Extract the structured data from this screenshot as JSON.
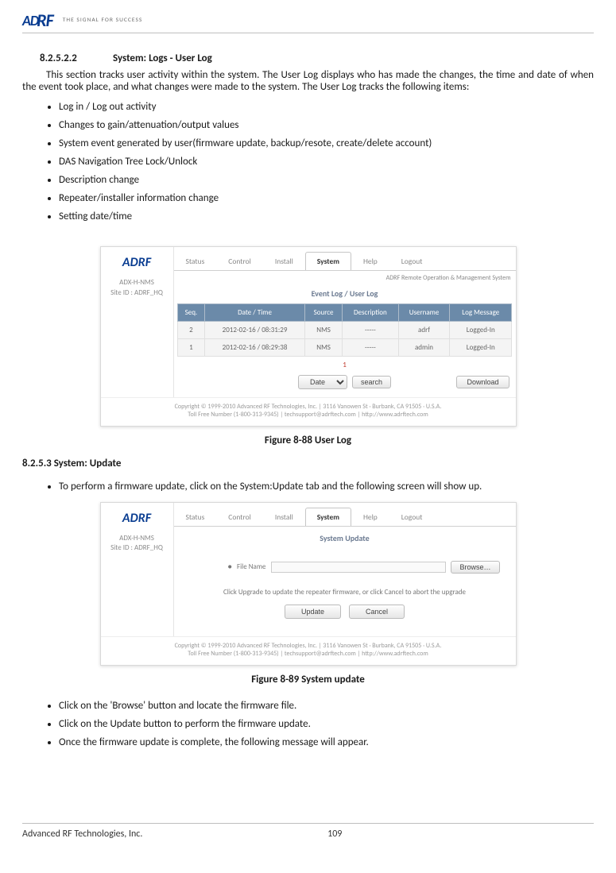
{
  "header": {
    "logo_letters": "AD",
    "logo_r": "RF",
    "tagline": "THE SIGNAL FOR SUCCESS"
  },
  "section1": {
    "num": "8.2.5.2.2",
    "title": "System: Logs - User Log",
    "para": "This section tracks user activity within the system.  The User Log displays who has made the changes, the time and date of when the event took place, and what changes were made to the system. The User Log tracks the following items:",
    "bullets": [
      "Log in / Log out activity",
      "Changes to gain/attenuation/output values",
      "System event generated by user(firmware update, backup/resote, create/delete account)",
      "DAS Navigation Tree Lock/Unlock",
      "Description change",
      "Repeater/installer information change",
      "Setting date/time"
    ]
  },
  "shot1": {
    "side_line1": "ADX-H-NMS",
    "side_line2": "Site ID : ADRF_HQ",
    "tabs": [
      "Status",
      "Control",
      "Install",
      "System",
      "Help",
      "Logout"
    ],
    "active_tab_index": 3,
    "right_note": "ADRF Remote Operation & Management System",
    "section_label": "Event Log / User Log",
    "cols": [
      "Seq.",
      "Date / Time",
      "Source",
      "Description",
      "Username",
      "Log Message"
    ],
    "rows": [
      {
        "seq": "2",
        "dt": "2012-02-16 / 08:31:29",
        "src": "NMS",
        "desc": "-----",
        "user": "adrf",
        "msg": "Logged-In"
      },
      {
        "seq": "1",
        "dt": "2012-02-16 / 08:29:38",
        "src": "NMS",
        "desc": "-----",
        "user": "admin",
        "msg": "Logged-In"
      }
    ],
    "pager": "1",
    "filter_select": "Date",
    "filter_btn": "search",
    "download_btn": "Download",
    "footer1": "Copyright © 1999-2010 Advanced RF Technologies, Inc. | 3116 Vanowen St · Burbank, CA 91505 · U.S.A.",
    "footer2": "Toll Free Number (1-800-313-9345) | techsupport@adrftech.com | http://www.adrftech.com"
  },
  "caption1": "Figure 8-88    User Log",
  "section2": {
    "heading": "8.2.5.3    System: Update",
    "bullet_top": "To perform a firmware update, click on the System:Update tab and the following screen will show up."
  },
  "shot2": {
    "side_line1": "ADX-H-NMS",
    "side_line2": "Site ID : ADRF_HQ",
    "tabs": [
      "Status",
      "Control",
      "Install",
      "System",
      "Help",
      "Logout"
    ],
    "active_tab_index": 3,
    "section_label": "System Update",
    "radio": "●",
    "file_label": "File Name",
    "browse": "Browse…",
    "msg": "Click Upgrade to update the repeater firmware, or click Cancel to abort the upgrade",
    "btn_update": "Update",
    "btn_cancel": "Cancel",
    "footer1": "Copyright © 1999-2010 Advanced RF Technologies, Inc. | 3116 Vanowen St · Burbank, CA 91505 · U.S.A.",
    "footer2": "Toll Free Number (1-800-313-9345) | techsupport@adrftech.com | http://www.adrftech.com"
  },
  "caption2": "Figure 8-89    System update",
  "after_bullets": [
    "Click on the 'Browse' button and locate the firmware file.",
    "Click on the Update button to perform the firmware update.",
    "Once the firmware update is complete, the following message will appear."
  ],
  "footer": {
    "company": "Advanced RF Technologies, Inc.",
    "page": "109"
  }
}
